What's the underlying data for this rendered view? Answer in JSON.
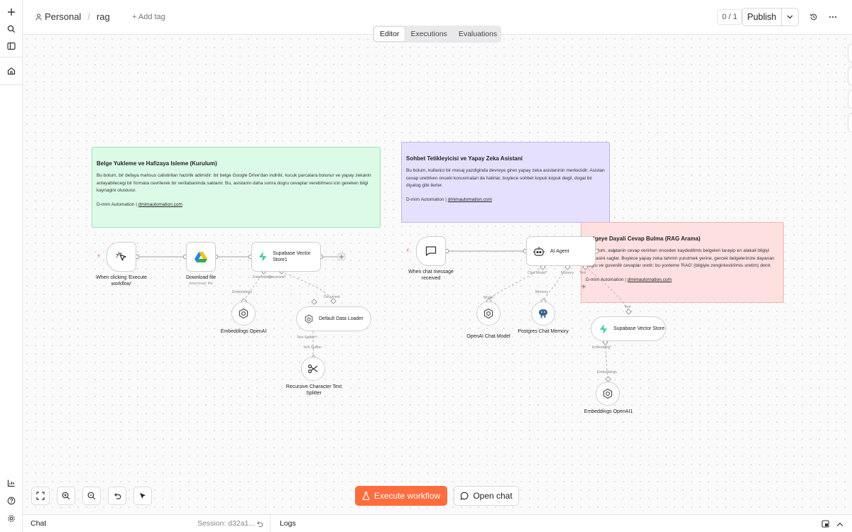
{
  "header": {
    "project": "Personal",
    "workflow_name": "rag",
    "add_tag": "+ Add tag",
    "counter": "0 / 1",
    "publish_label": "Publish"
  },
  "tabs": [
    {
      "label": "Editor",
      "active": true
    },
    {
      "label": "Executions",
      "active": false
    },
    {
      "label": "Evaluations",
      "active": false
    }
  ],
  "sticky_notes": [
    {
      "title": "Belge Yukleme ve Hafizaya Isleme (Kurulum)",
      "body": "Bu bolum, bir defaya mahsus calistirilan hazirlik adimidir: bir belge Google Drive'dan indirilir, kucuk parcalara bolunur ve yapay zekanin anlayabilecegi bir formata cevrilerek bir veritabaninda saklanir. Bu, asistanin daha sonra dogru cevaplar verebilmesi icin gereken bilgi kaynagini olusturur.",
      "credit_prefix": "D-mim Automation |",
      "credit_link": "dmimautomation.com",
      "color": "#dcfbe6"
    },
    {
      "title": "Sohbet Tetikleyicisi ve Yapay Zeka Asistani",
      "body": "Bu bolum, kullanici bir mesaj yazdiginda devreye giren yapay zeka asistaninin merkezidir. Asistan cevap uretirken onceki konusmalari da hatirlar, boylece sohbet kopuk kopuk degil, dogal bir diyalog gibi ilerler.",
      "credit_prefix": "D-mim Automation |",
      "credit_link": "dmimautomation.com",
      "color": "#e6e0ff"
    },
    {
      "title": "Belgeye Dayali Cevap Bulma (RAG Arama)",
      "body": "Bu bolum, asistanin cevap verirken onceden kaydedilmis belgeleri tarayip en alakali bilgiyi bulmasini saglar. Boylece yapay zeka tahmin yurutmek yerine, gercek belgelerinize dayanan dogru ve guvenilir cevaplar uretir; bu yonteme 'RAG' (bilgiyle zenginlestirilmis uretim) denir.",
      "credit_prefix": "D-mim Automation |",
      "credit_link": "dmimautomation.com",
      "color": "#ffe0e0"
    }
  ],
  "nodes": {
    "manual_trigger": "When clicking 'Execute workflow'",
    "download_file": "Download file",
    "download_file_sub": "download: file",
    "supabase_store1": "Supabase Vector Store1",
    "embeddings_openai": "Embeddings OpenAI",
    "data_loader": "Default Data Loader",
    "text_splitter": "Recursive Character Text Splitter",
    "chat_trigger": "When chat message received",
    "ai_agent": "AI Agent",
    "openai_chat_model": "OpenAI Chat Model",
    "postgres_memory": "Postgres Chat Memory",
    "supabase_store": "Supabase Vector Store",
    "embeddings_openai1": "Embeddings OpenAI1"
  },
  "ports": {
    "embeddings": "Embeddings",
    "embedding_req": "Embedding*",
    "document": "Document",
    "document_req": "Document*",
    "text_splitter_req": "Text Splitter*",
    "text_splitter": "Text Splitter",
    "chat_model_req": "Chat Model*",
    "memory": "Memory",
    "tool": "Tool",
    "model": "Model"
  },
  "actions": {
    "execute": "Execute workflow",
    "open_chat": "Open chat"
  },
  "bottom": {
    "chat": "Chat",
    "session": "Session: d32a1...",
    "logs": "Logs"
  },
  "colors": {
    "accent": "#ff6d3f",
    "supabase": "#3ecf8e"
  }
}
